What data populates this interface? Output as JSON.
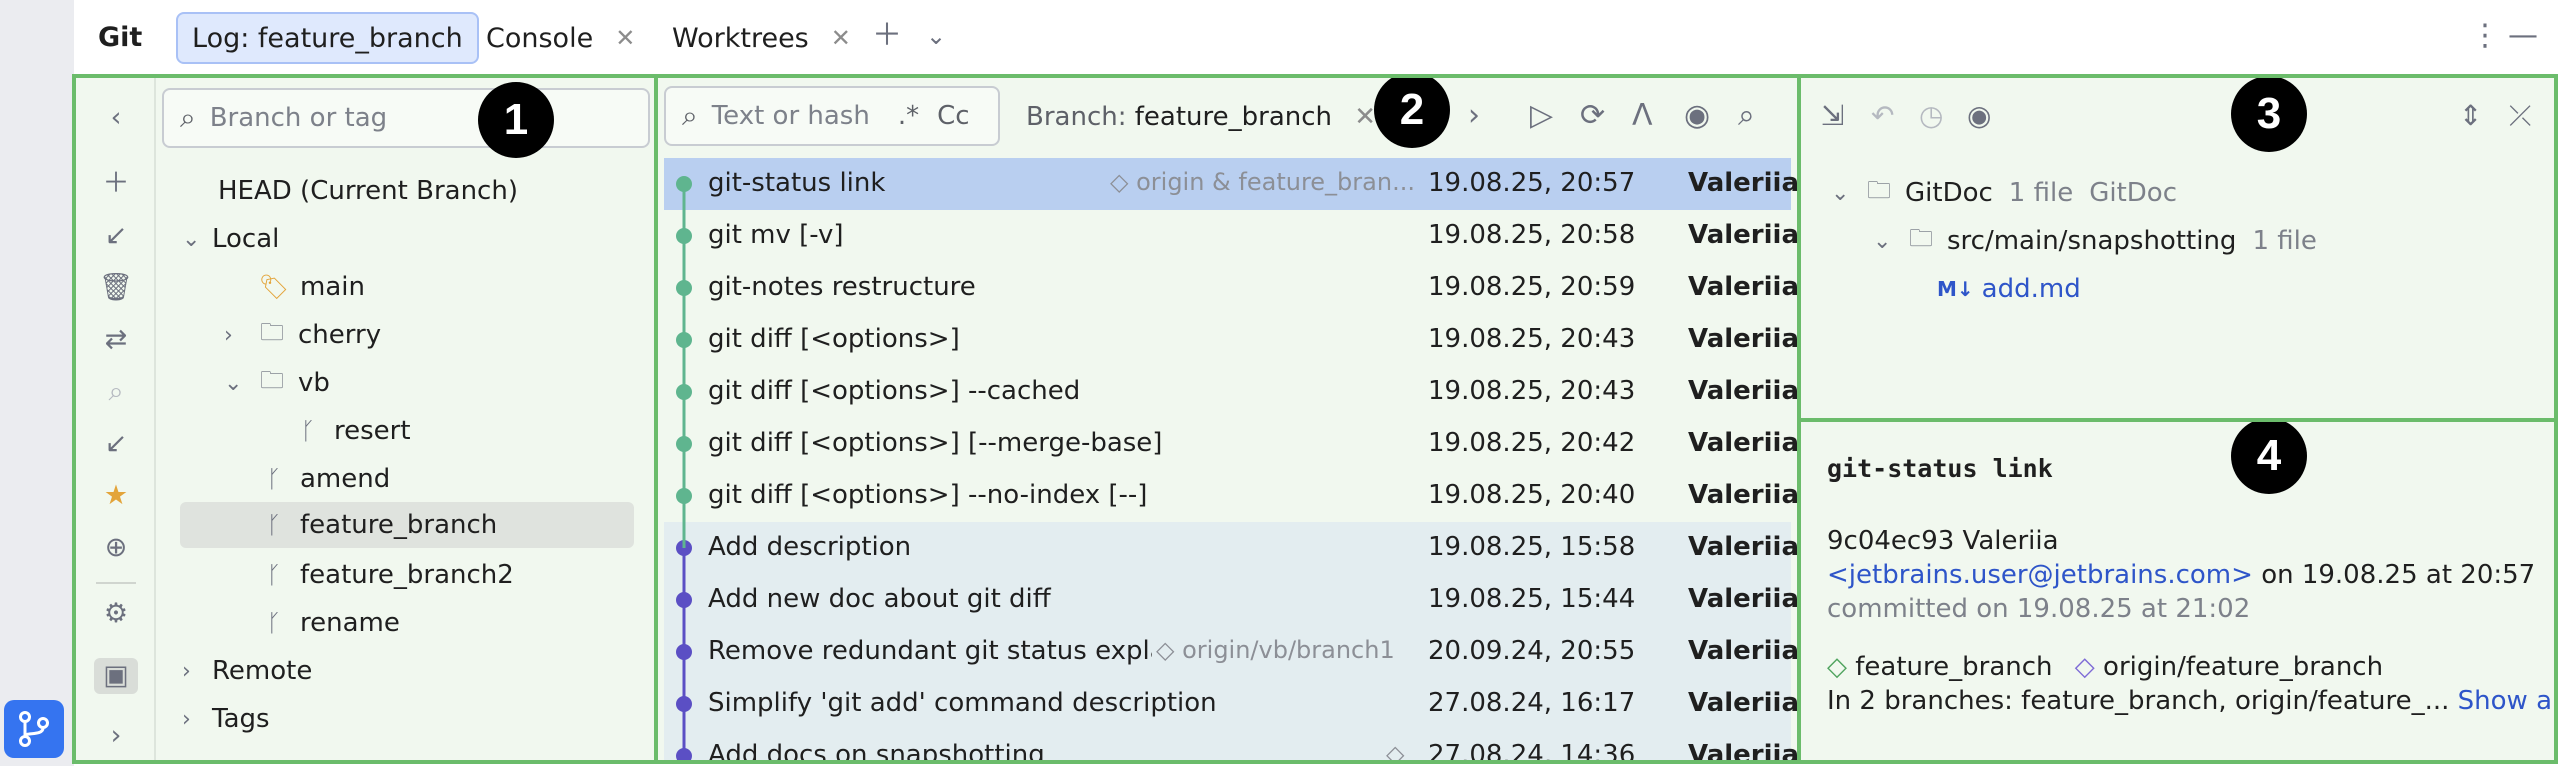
{
  "tabbar": {
    "tool_title": "Git",
    "tabs": [
      {
        "label": "Log: feature_branch",
        "active": true
      },
      {
        "label": "Console",
        "closable": true
      },
      {
        "label": "Worktrees",
        "closable": true
      }
    ]
  },
  "branches": {
    "search_placeholder": "Branch or tag",
    "head": "HEAD (Current Branch)",
    "local": "Local",
    "main": "main",
    "cherry": "cherry",
    "vb": "vb",
    "resert": "resert",
    "amend": "amend",
    "feature_branch": "feature_branch",
    "feature_branch2": "feature_branch2",
    "rename": "rename",
    "remote": "Remote",
    "tags": "Tags"
  },
  "log": {
    "search_placeholder": "Text or hash",
    "regex_label": ".*",
    "case_label": "Cc",
    "branch_filter_prefix": "Branch:",
    "branch_filter_value": "feature_branch",
    "commits": [
      {
        "message": "git-status link",
        "refs": "origin & feature_bran...",
        "date": "19.08.25, 20:57",
        "author": "Valeriia"
      },
      {
        "message": "git mv [-v]",
        "refs": "",
        "date": "19.08.25, 20:58",
        "author": "Valeriia"
      },
      {
        "message": "git-notes restructure",
        "refs": "",
        "date": "19.08.25, 20:59",
        "author": "Valeriia"
      },
      {
        "message": "git diff [<options>]",
        "refs": "",
        "date": "19.08.25, 20:43",
        "author": "Valeriia"
      },
      {
        "message": "git diff [<options>] --cached",
        "refs": "",
        "date": "19.08.25, 20:43",
        "author": "Valeriia"
      },
      {
        "message": "git diff [<options>] [--merge-base]",
        "refs": "",
        "date": "19.08.25, 20:42",
        "author": "Valeriia"
      },
      {
        "message": "git diff [<options>] --no-index [--]",
        "refs": "",
        "date": "19.08.25, 20:40",
        "author": "Valeriia"
      },
      {
        "message": "Add description",
        "refs": "",
        "date": "19.08.25, 15:58",
        "author": "Valeriia"
      },
      {
        "message": "Add new doc about git diff",
        "refs": "",
        "date": "19.08.25, 15:44",
        "author": "Valeriia"
      },
      {
        "message": "Remove redundant git status explan",
        "refs": "origin/vb/branch1",
        "date": "20.09.24, 20:55",
        "author": "Valeriia"
      },
      {
        "message": "Simplify 'git add' command description",
        "refs": "",
        "date": "27.08.24, 16:17",
        "author": "Valeriia"
      },
      {
        "message": "Add docs on snapshotting",
        "refs": "",
        "date": "27.08.24, 14:36",
        "author": "Valeriia"
      }
    ]
  },
  "changes": {
    "root_name": "GitDoc",
    "root_count": "1 file",
    "root_module": "GitDoc",
    "folder": "src/main/snapshotting",
    "folder_count": "1 file",
    "file_icon": "M↓",
    "file": "add.md"
  },
  "details": {
    "subject": "git-status link",
    "hash_author": "9c04ec93 Valeriia",
    "email": "<jetbrains.user@jetbrains.com>",
    "authored": "on 19.08.25 at 20:57",
    "committed": "committed on 19.08.25 at 21:02",
    "branch_local": "feature_branch",
    "branch_remote": "origin/feature_branch",
    "in_branches": "In 2 branches: feature_branch, origin/feature_...",
    "show_all": "Show all"
  },
  "badges": [
    "1",
    "2",
    "3",
    "4"
  ],
  "colors": {
    "pane_border": "#6bbc6b",
    "graph_green": "#5fb58f",
    "graph_purple": "#5b4fc4",
    "selection": "#b9cff0",
    "accent": "#3574f0"
  }
}
